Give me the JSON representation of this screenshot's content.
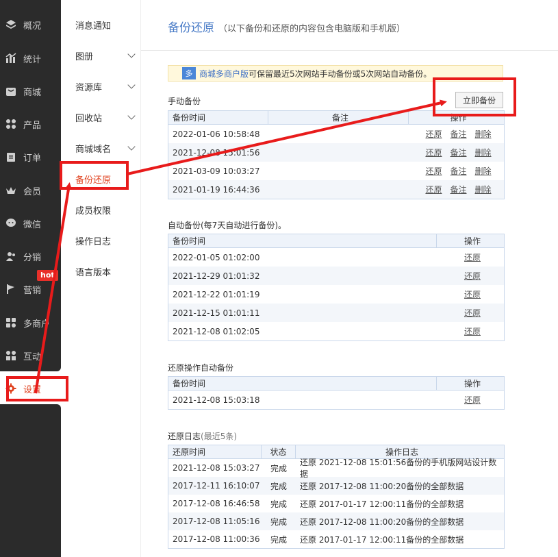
{
  "sidebar": {
    "items": [
      {
        "label": "概况",
        "icon": "layers-icon"
      },
      {
        "label": "统计",
        "icon": "bar-chart-icon"
      },
      {
        "label": "商城",
        "icon": "shop-icon"
      },
      {
        "label": "产品",
        "icon": "grid-icon"
      },
      {
        "label": "订单",
        "icon": "clipboard-icon"
      },
      {
        "label": "会员",
        "icon": "crown-icon"
      },
      {
        "label": "微信",
        "icon": "chat-icon"
      },
      {
        "label": "分销",
        "icon": "users-icon"
      },
      {
        "label": "营销",
        "icon": "flag-icon"
      },
      {
        "label": "多商户",
        "icon": "multi-shop-icon"
      },
      {
        "label": "互动",
        "icon": "interaction-icon"
      },
      {
        "label": "设置",
        "icon": "gear-icon"
      }
    ],
    "hot_badge": "hot"
  },
  "submenu": {
    "items": [
      {
        "label": "消息通知"
      },
      {
        "label": "图册"
      },
      {
        "label": "资源库"
      },
      {
        "label": "回收站"
      },
      {
        "label": "商城域名"
      },
      {
        "label": "备份还原"
      },
      {
        "label": "成员权限"
      },
      {
        "label": "操作日志"
      },
      {
        "label": "语言版本"
      }
    ]
  },
  "page": {
    "title": "备份还原",
    "subtitle": "（以下备份和还原的内容包含电脑版和手机版）"
  },
  "notice": {
    "badge": "多",
    "link": "商城多商户版",
    "text": "可保留最近5次网站手动备份或5次网站自动备份。"
  },
  "manual": {
    "title": "手动备份",
    "button": "立即备份",
    "headers": [
      "备份时间",
      "备注",
      "操作"
    ],
    "actions": [
      "还原",
      "备注",
      "删除"
    ],
    "rows": [
      {
        "time": "2022-01-06 10:58:48"
      },
      {
        "time": "2021-12-08 15:01:56"
      },
      {
        "time": "2021-03-09 10:03:27"
      },
      {
        "time": "2021-01-19 16:44:36"
      }
    ]
  },
  "auto": {
    "title": "自动备份(每7天自动进行备份)。",
    "headers": [
      "备份时间",
      "操作"
    ],
    "action": "还原",
    "rows": [
      {
        "time": "2022-01-05 01:02:00"
      },
      {
        "time": "2021-12-29 01:01:32"
      },
      {
        "time": "2021-12-22 01:01:19"
      },
      {
        "time": "2021-12-15 01:01:11"
      },
      {
        "time": "2021-12-08 01:02:05"
      }
    ]
  },
  "restore_auto": {
    "title": "还原操作自动备份",
    "headers": [
      "备份时间",
      "操作"
    ],
    "action": "还原",
    "rows": [
      {
        "time": "2021-12-08 15:03:18"
      }
    ]
  },
  "log": {
    "title": "还原日志",
    "title_note": "(最近5条)",
    "headers": [
      "还原时间",
      "状态",
      "操作日志"
    ],
    "rows": [
      {
        "time": "2021-12-08 15:03:27",
        "status": "完成",
        "detail": "还原 2021-12-08 15:01:56备份的手机版网站设计数据"
      },
      {
        "time": "2017-12-11 16:10:07",
        "status": "完成",
        "detail": "还原 2017-12-08 11:00:20备份的全部数据"
      },
      {
        "time": "2017-12-08 16:46:58",
        "status": "完成",
        "detail": "还原 2017-01-17 12:00:11备份的全部数据"
      },
      {
        "time": "2017-12-08 11:05:16",
        "status": "完成",
        "detail": "还原 2017-12-08 11:00:20备份的全部数据"
      },
      {
        "time": "2017-12-08 11:00:36",
        "status": "完成",
        "detail": "还原 2017-01-17 12:00:11备份的全部数据"
      }
    ]
  },
  "colors": {
    "accent": "#e0421f",
    "title_blue": "#4a7cc7",
    "annotation_red": "#e81b1b",
    "sidebar_bg": "#2b2b2b"
  }
}
